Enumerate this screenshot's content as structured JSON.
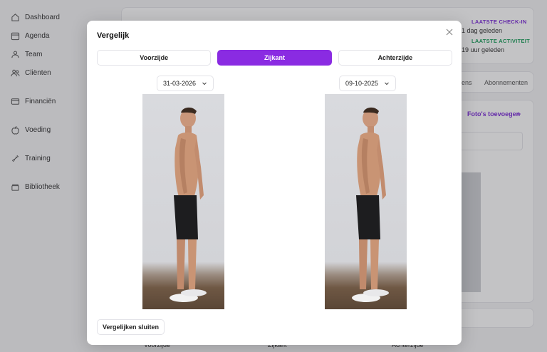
{
  "sidebar": {
    "items": [
      {
        "label": "Dashboard",
        "icon": "home-icon"
      },
      {
        "label": "Agenda",
        "icon": "calendar-icon"
      },
      {
        "label": "Team",
        "icon": "team-icon"
      },
      {
        "label": "Cliënten",
        "icon": "clients-icon"
      },
      {
        "label": "Financiën",
        "icon": "card-icon"
      },
      {
        "label": "Voeding",
        "icon": "apple-icon"
      },
      {
        "label": "Training",
        "icon": "dumbbell-icon"
      },
      {
        "label": "Bibliotheek",
        "icon": "library-icon"
      }
    ]
  },
  "background": {
    "last_checkin_label": "LAATSTE CHECK-IN",
    "last_checkin_value": "1 dag geleden",
    "last_activity_label": "LAATSTE ACTIVITEIT",
    "last_activity_value": "19 uur geleden",
    "tab_partial": "ens",
    "tab_subscriptions": "Abonnementen",
    "add_photos": "Foto's toevoegen",
    "add_plus": "+",
    "footer_front": "Voorzijde",
    "footer_side": "Zijkant",
    "footer_back": "Achterzijde"
  },
  "modal": {
    "title": "Vergelijk",
    "tabs": [
      {
        "label": "Voorzijde",
        "active": false
      },
      {
        "label": "Zijkant",
        "active": true
      },
      {
        "label": "Achterzijde",
        "active": false
      }
    ],
    "left_date": "31-03-2026",
    "right_date": "09-10-2025",
    "close_compare_label": "Vergelijken sluiten"
  },
  "colors": {
    "accent": "#8a2be2",
    "checkin": "#7c2cd9",
    "activity": "#1a9e5a"
  }
}
